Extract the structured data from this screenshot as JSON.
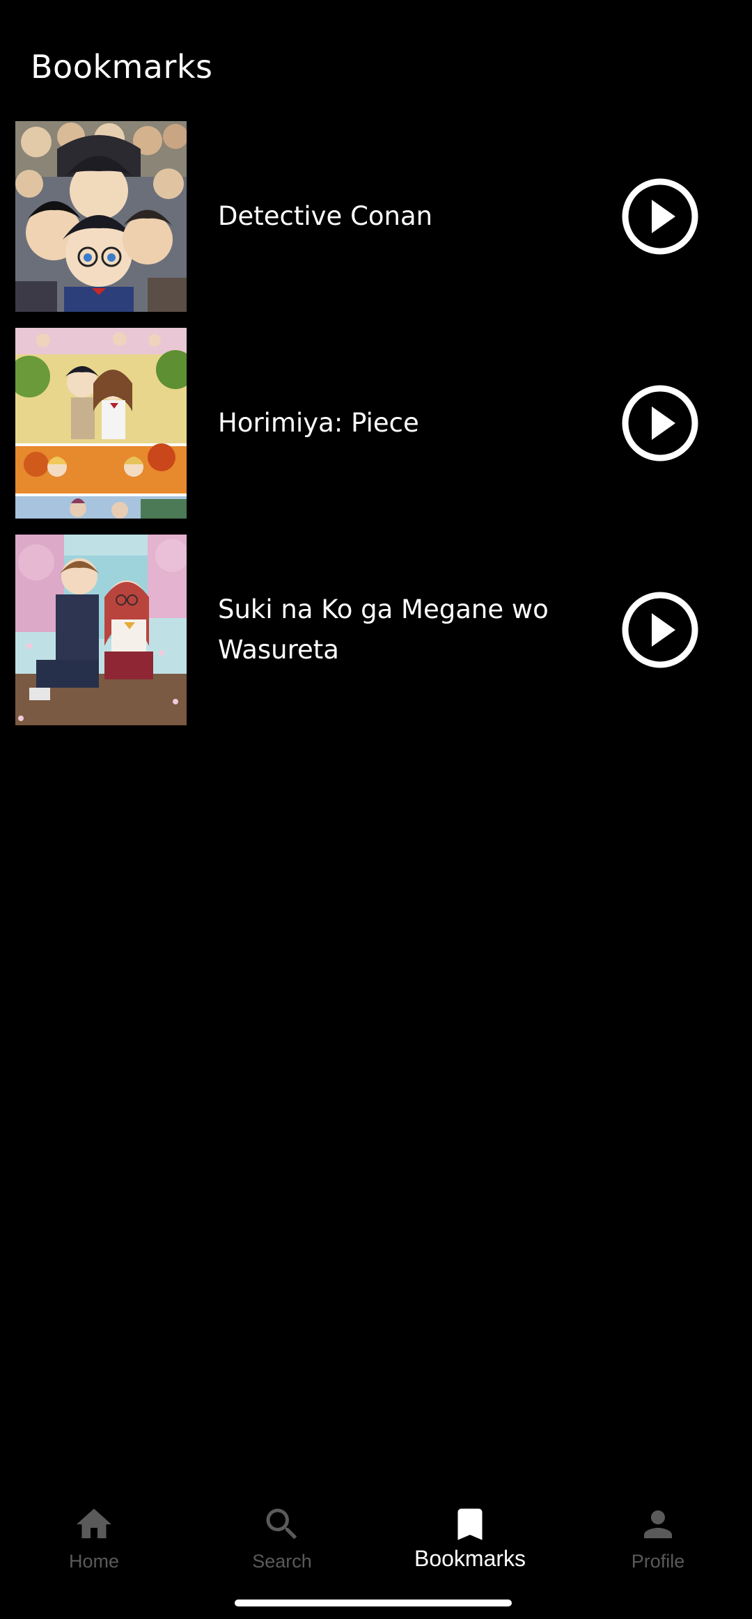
{
  "header": {
    "title": "Bookmarks"
  },
  "bookmarks": [
    {
      "title": "Detective Conan",
      "poster": "detective-conan-poster"
    },
    {
      "title": "Horimiya: Piece",
      "poster": "horimiya-piece-poster"
    },
    {
      "title": "Suki na Ko ga Megane wo Wasureta",
      "poster": "suki-na-ko-poster"
    }
  ],
  "bottom_nav": {
    "items": [
      {
        "label": "Home",
        "icon": "home-icon",
        "active": false
      },
      {
        "label": "Search",
        "icon": "search-icon",
        "active": false
      },
      {
        "label": "Bookmarks",
        "icon": "bookmark-icon",
        "active": true
      },
      {
        "label": "Profile",
        "icon": "person-icon",
        "active": false
      }
    ]
  },
  "colors": {
    "background": "#000000",
    "text": "#ffffff",
    "inactive_nav": "#5a5a5a"
  }
}
